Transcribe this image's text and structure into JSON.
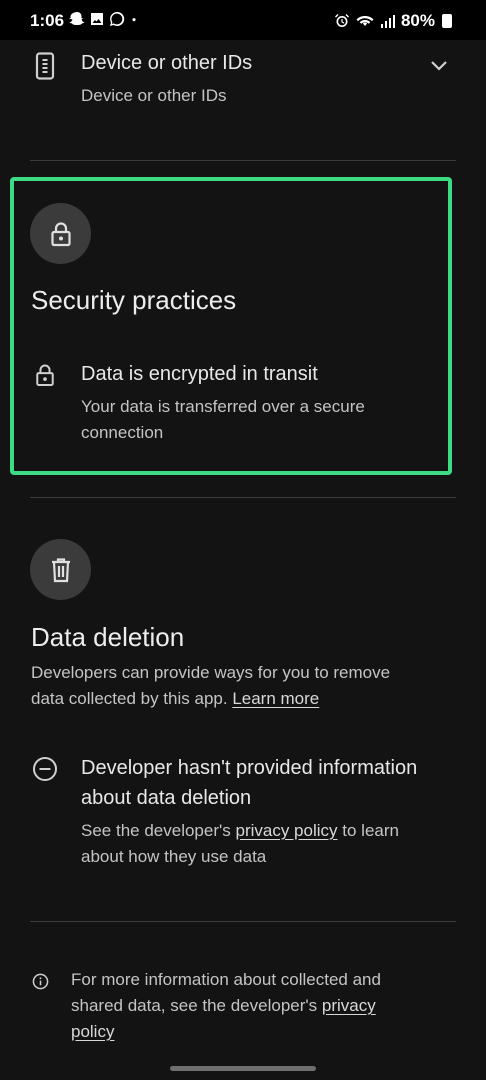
{
  "status_bar": {
    "time": "1:06",
    "battery": "80%",
    "notification_icons": [
      "snapchat-icon",
      "gallery-icon",
      "whatsapp-icon",
      "dot-icon"
    ],
    "system_icons": [
      "alarm-icon",
      "wifi-icon",
      "signal-icon",
      "battery-icon"
    ]
  },
  "device_ids": {
    "title": "Device or other IDs",
    "subtitle": "Device or other IDs",
    "icon": "phone-icon"
  },
  "security": {
    "title": "Security practices",
    "icon": "lock-icon",
    "item_title": "Data is encrypted in transit",
    "item_desc_line1": "Your data is transferred over a secure",
    "item_desc_line2": "connection",
    "highlight_color": "#3ddc84"
  },
  "deletion": {
    "title": "Data deletion",
    "icon": "trash-icon",
    "desc_line1": "Developers can provide ways for you to remove",
    "desc_line2": "data collected by this app.",
    "learn_more": "Learn more",
    "item_title_line1": "Developer hasn't provided information",
    "item_title_line2": "about data deletion",
    "item_desc_pre": "See the developer's",
    "item_desc_link": "privacy policy",
    "item_desc_post": "to learn",
    "item_desc_line2": "about how they use data"
  },
  "footer": {
    "line1": "For more information about collected and",
    "line2_pre": "shared data, see the developer's",
    "line2_link": "privacy",
    "line3_link": "policy",
    "icon": "info-icon"
  }
}
